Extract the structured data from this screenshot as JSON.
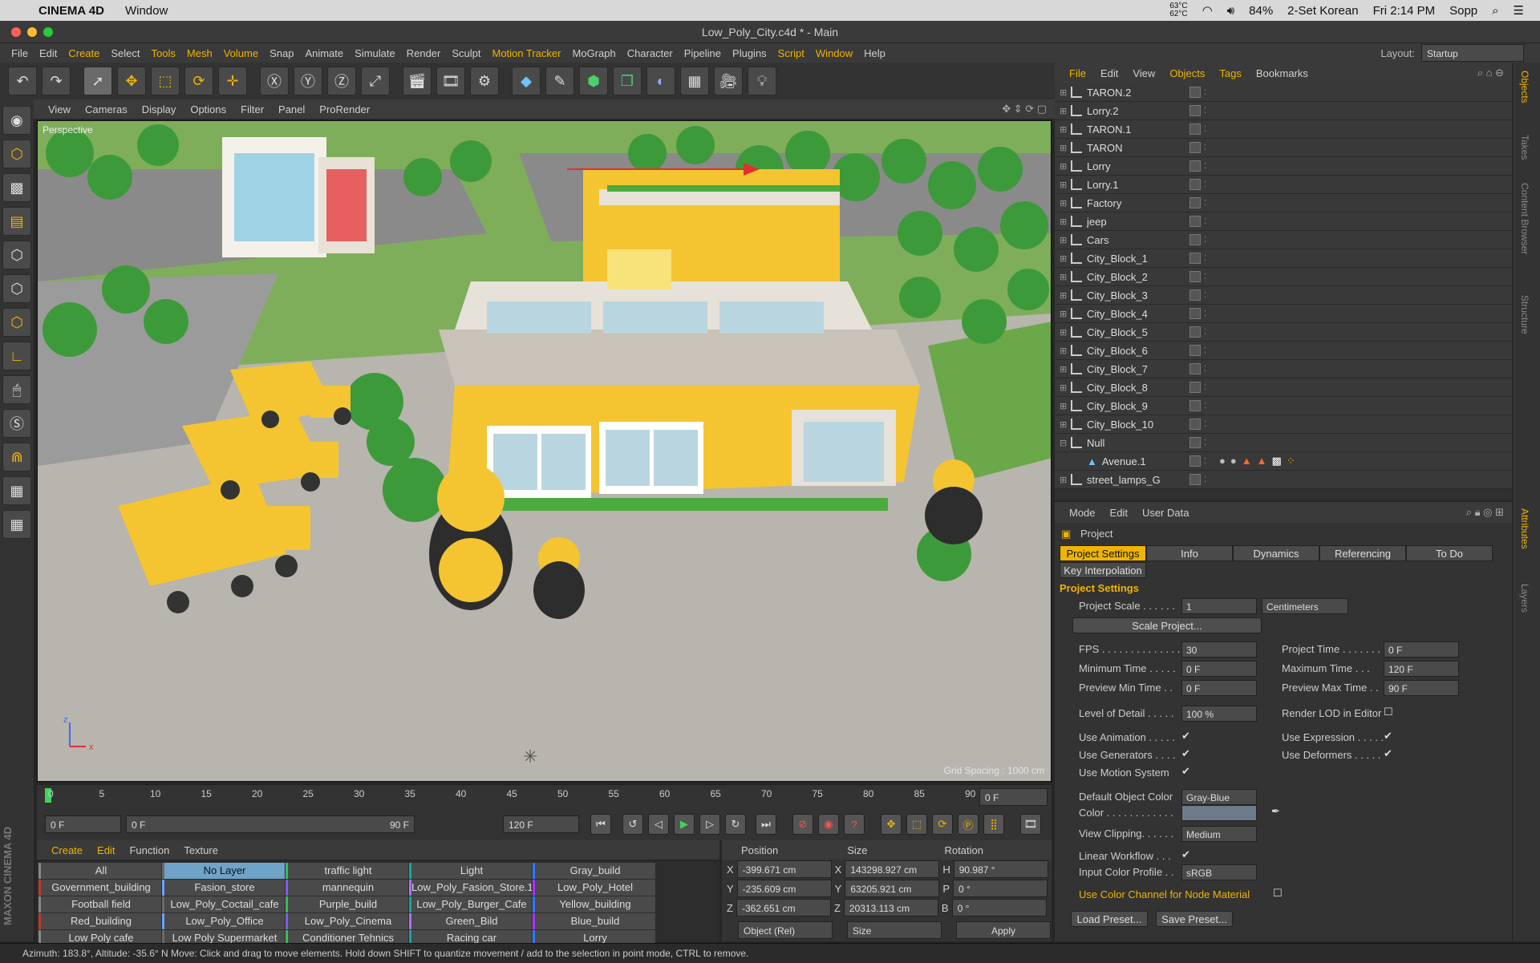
{
  "mac": {
    "app": "CINEMA 4D",
    "menu": "Window",
    "input": "2-Set Korean",
    "time": "Fri 2:14 PM",
    "user": "Sopp",
    "battery": "84%",
    "temp1": "63°C",
    "temp2": "62°C"
  },
  "window": {
    "title": "Low_Poly_City.c4d * - Main"
  },
  "menubar": [
    "File",
    "Edit",
    "Create",
    "Select",
    "Tools",
    "Mesh",
    "Volume",
    "Snap",
    "Animate",
    "Simulate",
    "Render",
    "Sculpt",
    "Motion Tracker",
    "MoGraph",
    "Character",
    "Pipeline",
    "Plugins",
    "Script",
    "Window",
    "Help"
  ],
  "layout": {
    "label": "Layout:",
    "value": "Startup"
  },
  "viewport": {
    "menu": [
      "View",
      "Cameras",
      "Display",
      "Options",
      "Filter",
      "Panel",
      "ProRender"
    ],
    "camera": "Perspective",
    "grid": "Grid Spacing : 1000 cm"
  },
  "timeline": {
    "ticks": [
      "0",
      "5",
      "10",
      "15",
      "20",
      "25",
      "30",
      "35",
      "40",
      "45",
      "50",
      "55",
      "60",
      "65",
      "70",
      "75",
      "80",
      "85",
      "90"
    ],
    "current": "0 F",
    "start": "0 F",
    "range_start": "0 F",
    "range_end": "90 F",
    "end": "120 F"
  },
  "materials": {
    "menu": [
      "Create",
      "Edit",
      "Function",
      "Texture"
    ],
    "items": [
      "All",
      "No Layer",
      "traffic light",
      "Light",
      "Gray_build",
      "Government_building",
      "Fasion_store",
      "mannequin",
      "Low_Poly_Fasion_Store.1",
      "Low_Poly_Hotel",
      "Football field",
      "Low_Poly_Coctail_cafe",
      "Purple_build",
      "Low_Poly_Burger_Cafe",
      "Yellow_building",
      "Red_building",
      "Low_Poly_Office",
      "Low_Poly_Cinema",
      "Green_Bild",
      "Blue_build",
      "Low Poly cafe",
      "Low Poly Supermarket",
      "Conditioner Tehnics",
      "Racing car",
      "Lorry"
    ]
  },
  "coords": {
    "headers": [
      "Position",
      "Size",
      "Rotation"
    ],
    "rows": [
      {
        "a": "X",
        "p": "-399.671 cm",
        "b": "X",
        "s": "143298.927 cm",
        "c": "H",
        "r": "90.987 °"
      },
      {
        "a": "Y",
        "p": "-235.609 cm",
        "b": "Y",
        "s": "63205.921 cm",
        "c": "P",
        "r": "0 °"
      },
      {
        "a": "Z",
        "p": "-362.651 cm",
        "b": "Z",
        "s": "20313.113 cm",
        "c": "B",
        "r": "0 °"
      }
    ],
    "mode": "Object (Rel)",
    "sizeMode": "Size",
    "apply": "Apply"
  },
  "objects": {
    "menu": [
      "File",
      "Edit",
      "View",
      "Objects",
      "Tags",
      "Bookmarks"
    ],
    "items": [
      "TARON.2",
      "Lorry.2",
      "TARON.1",
      "TARON",
      "Lorry",
      "Lorry.1",
      "Factory",
      "jeep",
      "Cars",
      "City_Block_1",
      "City_Block_2",
      "City_Block_3",
      "City_Block_4",
      "City_Block_5",
      "City_Block_6",
      "City_Block_7",
      "City_Block_8",
      "City_Block_9",
      "City_Block_10",
      "Null",
      "Avenue.1",
      "street_lamps_G"
    ]
  },
  "sidetabs": [
    "Objects",
    "Takes",
    "Content Browser",
    "Structure",
    "Attributes",
    "Layers"
  ],
  "attributes": {
    "menu": [
      "Mode",
      "Edit",
      "User Data"
    ],
    "title": "Project",
    "tabs": [
      "Project Settings",
      "Info",
      "Dynamics",
      "Referencing",
      "To Do"
    ],
    "tab2": "Key Interpolation",
    "section": "Project Settings",
    "scale_label": "Project Scale . . . . . .",
    "scale": "1",
    "units": "Centimeters",
    "scale_btn": "Scale Project...",
    "fps_label": "FPS . . . . . . . . . . . . . .",
    "fps": "30",
    "ptime_label": "Project Time . . . . . . .",
    "ptime": "0 F",
    "mintime_label": "Minimum Time . . . . .",
    "mintime": "0 F",
    "maxtime_label": "Maximum Time . . .",
    "maxtime": "120 F",
    "prevmin_label": "Preview Min Time . .",
    "prevmin": "0 F",
    "prevmax_label": "Preview Max Time . .",
    "prevmax": "90 F",
    "lod_label": "Level of Detail . . . . .",
    "lod": "100 %",
    "renderlod": "Render LOD in Editor",
    "useanim": "Use Animation . . . . .",
    "useexpr": "Use Expression . . . . .",
    "usegen": "Use Generators . . . .",
    "usedef": "Use Deformers . . . . .",
    "usemotion": "Use Motion System",
    "defcolor_label": "Default Object Color",
    "defcolor": "Gray-Blue",
    "color_label": "Color . . . . . . . . . . . .",
    "clip_label": "View Clipping. . . . . .",
    "clip": "Medium",
    "linear": "Linear Workflow . . .",
    "profile_label": "Input Color Profile . .",
    "profile": "sRGB",
    "colorchannel": "Use Color Channel for Node Material",
    "load": "Load Preset...",
    "save": "Save Preset..."
  },
  "status": "Azimuth: 183.8°, Altitude: -35.6°  N     Move: Click and drag to move elements. Hold down SHIFT to quantize movement / add to the selection in point mode, CTRL to remove.",
  "brand": "MAXON CINEMA 4D",
  "colors": {
    "accent": "#f0b400",
    "building": "#f4c531",
    "ground": "#b8b4ae",
    "grass": "#5da83c",
    "tree": "#3d9a3a"
  }
}
